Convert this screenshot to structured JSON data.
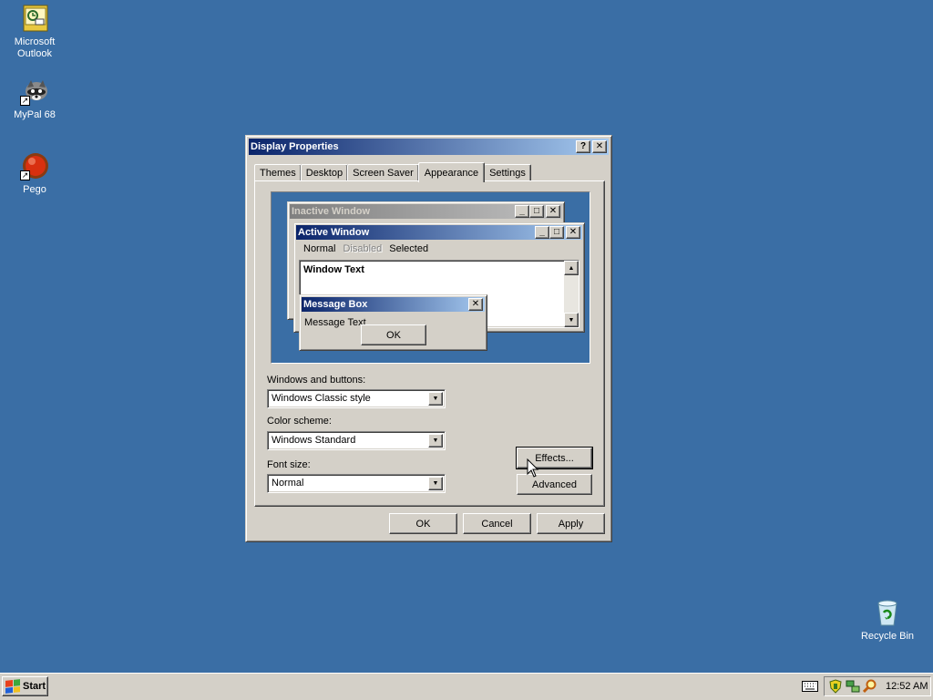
{
  "desktop": {
    "icons": [
      {
        "label_line1": "Microsoft",
        "label_line2": "Outlook",
        "icon": "outlook-icon"
      },
      {
        "label_line1": "MyPal 68",
        "label_line2": "",
        "icon": "mypal-icon"
      },
      {
        "label_line1": "Pego",
        "label_line2": "",
        "icon": "pego-icon"
      },
      {
        "label_line1": "Recycle Bin",
        "label_line2": "",
        "icon": "recycle-bin-icon"
      }
    ],
    "background_color": "#3a6ea5"
  },
  "dialog": {
    "title": "Display Properties",
    "help_glyph": "?",
    "close_glyph": "✕",
    "tabs": [
      {
        "label": "Themes"
      },
      {
        "label": "Desktop"
      },
      {
        "label": "Screen Saver"
      },
      {
        "label": "Appearance"
      },
      {
        "label": "Settings"
      }
    ],
    "active_tab": "Appearance",
    "preview": {
      "inactive_title": "Inactive Window",
      "active_title": "Active Window",
      "menu_normal": "Normal",
      "menu_disabled": "Disabled",
      "menu_selected": "Selected",
      "window_text": "Window Text",
      "message_box_title": "Message Box",
      "message_text": "Message Text",
      "ok_label": "OK"
    },
    "windows_and_buttons": {
      "label": "Windows and buttons:",
      "value": "Windows Classic style"
    },
    "color_scheme": {
      "label": "Color scheme:",
      "value": "Windows Standard"
    },
    "font_size": {
      "label": "Font size:",
      "value": "Normal"
    },
    "effects_label": "Effects...",
    "advanced_label": "Advanced",
    "ok_label": "OK",
    "cancel_label": "Cancel",
    "apply_label": "Apply"
  },
  "taskbar": {
    "start_label": "Start",
    "clock": "12:52 AM",
    "tray_icons": [
      "shield-icon",
      "network-icon",
      "search-icon"
    ]
  },
  "colors": {
    "title_active_start": "#0a246a",
    "title_active_end": "#a6caf0",
    "face": "#d4d0c8"
  }
}
